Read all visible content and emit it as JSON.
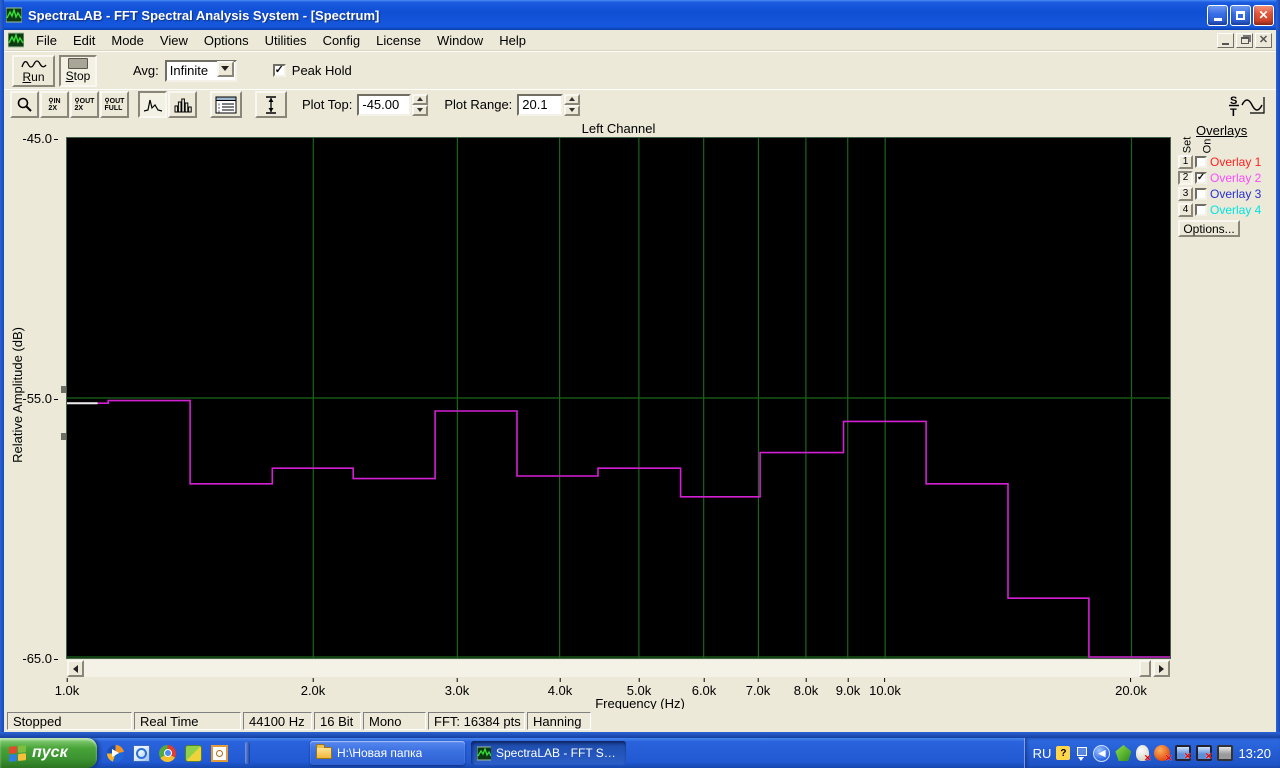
{
  "window": {
    "title": "SpectraLAB - FFT Spectral Analysis System - [Spectrum]"
  },
  "menu": {
    "items": [
      "File",
      "Edit",
      "Mode",
      "View",
      "Options",
      "Utilities",
      "Config",
      "License",
      "Window",
      "Help"
    ]
  },
  "toolbar": {
    "run_label": "Run",
    "stop_label": "Stop",
    "avg_label": "Avg:",
    "avg_value": "Infinite",
    "peak_hold_label": "Peak Hold",
    "zoom_in_l1": "IN",
    "zoom_in_l2": "2X",
    "zoom_out_l1": "OUT",
    "zoom_out_l2": "2X",
    "zoom_full_l1": "OUT",
    "zoom_full_l2": "FULL",
    "plot_top_label": "Plot Top:",
    "plot_top_value": "-45.00",
    "plot_range_label": "Plot Range:",
    "plot_range_value": "20.1"
  },
  "chart": {
    "title": "Left Channel",
    "xlabel": "Frequency (Hz)",
    "ylabel": "Relative Amplitude (dB)",
    "yticks": [
      "-45.0",
      "-55.0",
      "-65.0"
    ]
  },
  "chart_data": {
    "type": "step-line",
    "description": "Peak-hold 1/3-octave style spectrum trace (Overlay 2)",
    "title": "Left Channel",
    "xlabel": "Frequency (Hz)",
    "ylabel": "Relative Amplitude (dB)",
    "x_scale": "log",
    "xlim_hz": [
      1000,
      22290
    ],
    "ylim_db": [
      -65,
      -45
    ],
    "x_gridlines_hz": [
      2000,
      3000,
      4000,
      5000,
      6000,
      7000,
      8000,
      9000,
      10000,
      20000
    ],
    "y_gridlines_db": [
      -55,
      -65
    ],
    "x_ticks": [
      {
        "label": "1.0k",
        "hz": 1000
      },
      {
        "label": "2.0k",
        "hz": 2000
      },
      {
        "label": "3.0k",
        "hz": 3000
      },
      {
        "label": "4.0k",
        "hz": 4000
      },
      {
        "label": "5.0k",
        "hz": 5000
      },
      {
        "label": "6.0k",
        "hz": 6000
      },
      {
        "label": "7.0k",
        "hz": 7000
      },
      {
        "label": "8.0k",
        "hz": 8000
      },
      {
        "label": "9.0k",
        "hz": 9000
      },
      {
        "label": "10.0k",
        "hz": 10000
      },
      {
        "label": "20.0k",
        "hz": 20000
      }
    ],
    "series": [
      {
        "name": "Overlay 2 peak hold",
        "color": "#d420d4",
        "band_edges_hz": [
          1000,
          1123,
          1414,
          1782,
          2238,
          2818,
          3548,
          4456,
          5623,
          7033,
          8892,
          11220,
          14130,
          17740,
          22290
        ],
        "band_levels_db": [
          -55.2,
          -55.1,
          -58.3,
          -57.7,
          -58.1,
          -55.5,
          -58.0,
          -57.7,
          -58.8,
          -57.1,
          -55.9,
          -58.3,
          -62.7,
          -65.0
        ]
      }
    ],
    "start_marker": {
      "hz_range": [
        1000,
        1090
      ],
      "db": -55.2,
      "color": "#ececec"
    },
    "grid_color": "#1a651a",
    "background": "#000000"
  },
  "overlays": {
    "heading": "Overlays",
    "set_label": "Set",
    "on_label": "On",
    "items": [
      {
        "set": "1",
        "label": "Overlay 1",
        "color": "#ff2020",
        "checked": false,
        "pressed": false
      },
      {
        "set": "2",
        "label": "Overlay 2",
        "color": "#ff4aff",
        "checked": true,
        "pressed": true
      },
      {
        "set": "3",
        "label": "Overlay 3",
        "color": "#2830d0",
        "checked": false,
        "pressed": false
      },
      {
        "set": "4",
        "label": "Overlay 4",
        "color": "#00e4e4",
        "checked": false,
        "pressed": false
      }
    ],
    "options_label": "Options..."
  },
  "statusbar": {
    "cells": [
      "Stopped",
      "Real Time",
      "44100 Hz",
      "16 Bit",
      "Mono",
      "FFT: 16384 pts",
      "Hanning"
    ]
  },
  "taskbar": {
    "start_label": "пуск",
    "quick_launch_icons": [
      "media-player-icon",
      "browser-icon",
      "chrome-icon",
      "update-icon",
      "scheduler-icon"
    ],
    "tasks": [
      {
        "label": "H:\\Новая папка",
        "icon": "folder",
        "active": false
      },
      {
        "label": "SpectraLAB - FFT Spe…",
        "icon": "app",
        "active": true
      }
    ],
    "tray": {
      "lang": "RU",
      "time": "13:20",
      "icons": [
        "help-icon",
        "window-layout-icon",
        "hide-icons-chevron",
        "agent-icon",
        "messenger-offline-icon",
        "security-alert-icon",
        "network-offline-icon",
        "network-offline-2-icon",
        "display-icon"
      ]
    }
  }
}
